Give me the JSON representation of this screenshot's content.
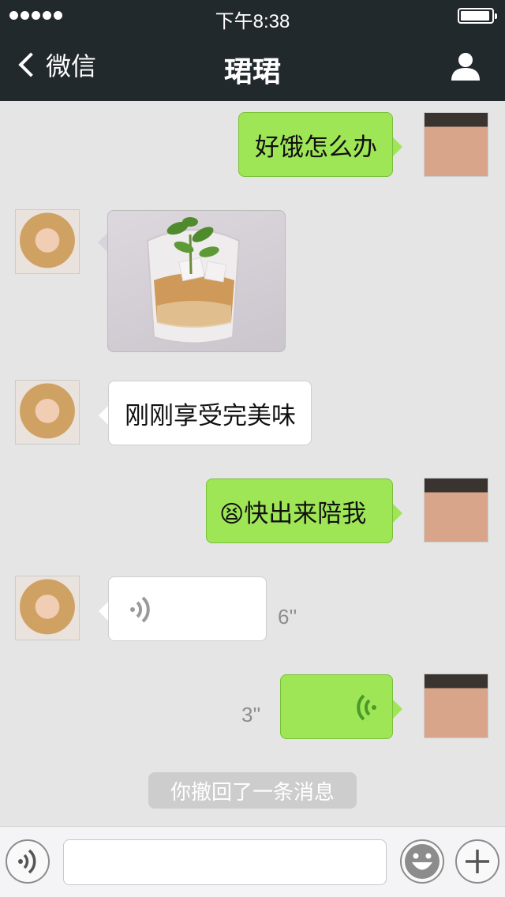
{
  "status_bar": {
    "time": "下午8:38",
    "signal_dots": 5,
    "battery_level": 0.95
  },
  "nav": {
    "back_label": "微信",
    "title": "珺珺",
    "back_icon": "chevron-left-icon",
    "profile_icon": "person-icon"
  },
  "messages": [
    {
      "sender": "self",
      "type": "text",
      "text": "好饿怎么办"
    },
    {
      "sender": "other",
      "type": "image",
      "description": "photo-drink"
    },
    {
      "sender": "other",
      "type": "text",
      "text": "刚刚享受完美味"
    },
    {
      "sender": "self",
      "type": "text",
      "emoji": "😫",
      "text": "快出来陪我"
    },
    {
      "sender": "other",
      "type": "voice",
      "duration": "6''"
    },
    {
      "sender": "self",
      "type": "voice",
      "duration": "3''"
    }
  ],
  "system_notice": "你撤回了一条消息",
  "input_bar": {
    "voice_icon": "voice-icon",
    "emoji_icon": "smiley-icon",
    "plus_icon": "plus-icon",
    "placeholder": ""
  },
  "colors": {
    "nav_bg": "#22292c",
    "bubble_green": "#9fe657",
    "voice_wave_self": "#4a9a2a"
  }
}
